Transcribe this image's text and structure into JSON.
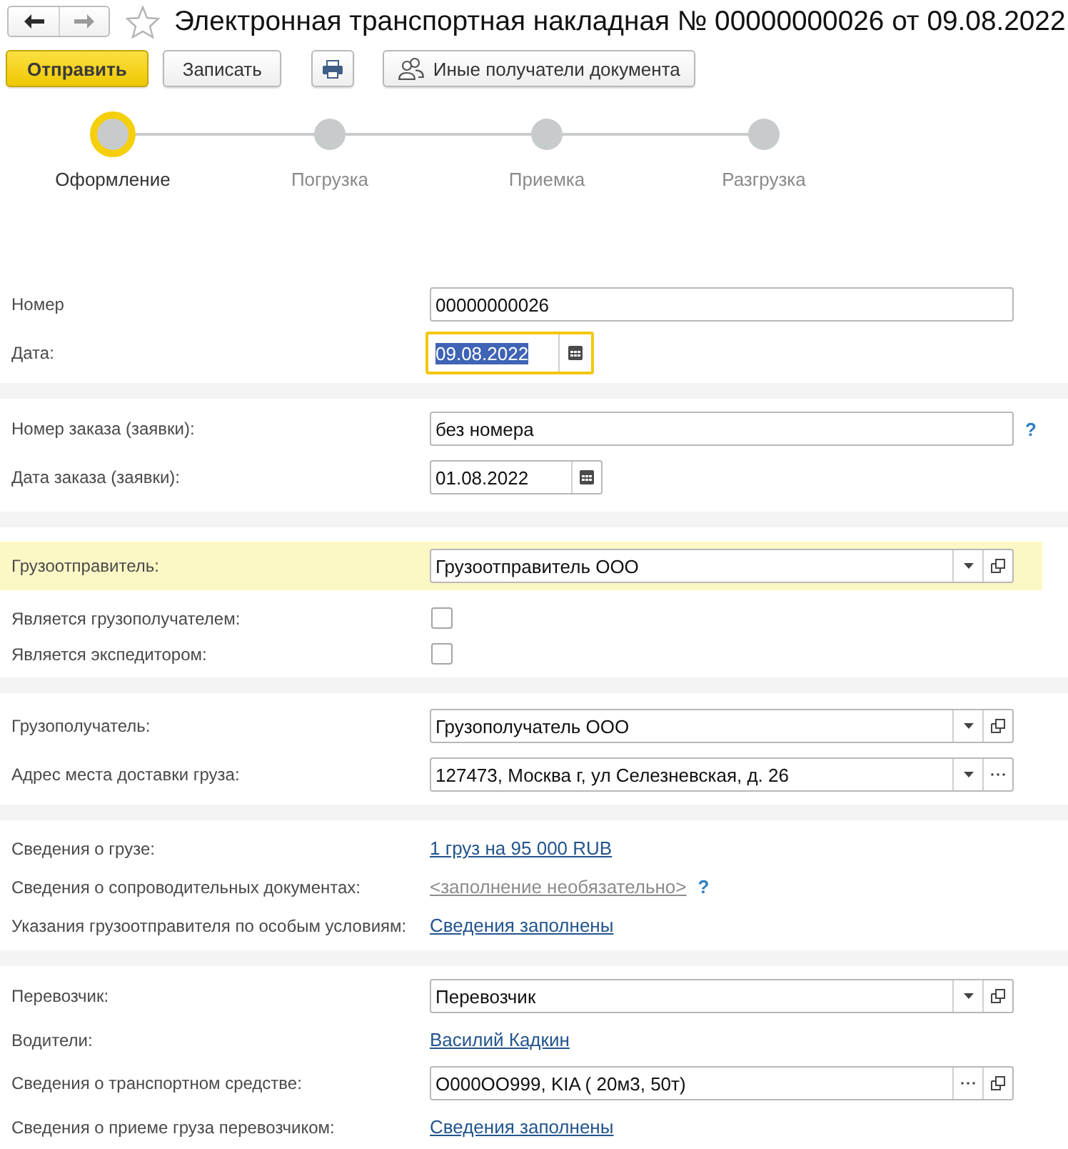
{
  "window": {
    "title": "Электронная транспортная накладная № 00000000026 от 09.08.2022",
    "favorite": false
  },
  "nav_buttons": [
    {
      "kind": "back",
      "disabled": false
    },
    {
      "kind": "forward",
      "disabled": true
    }
  ],
  "toolbar": [
    {
      "kind": "primary",
      "label": "Отправить"
    },
    {
      "kind": "plain",
      "label": "Записать"
    },
    {
      "kind": "print"
    },
    {
      "kind": "people",
      "label": "Иные получатели документа"
    }
  ],
  "steps": [
    {
      "label": "Оформление",
      "selected": true
    },
    {
      "label": "Погрузка",
      "selected": false
    },
    {
      "label": "Приемка",
      "selected": false
    },
    {
      "label": "Разгрузка",
      "selected": false
    }
  ],
  "sections": [
    {
      "rows": [
        {
          "kind": "text",
          "label": "Номер",
          "value": "00000000026",
          "focused": false,
          "highlighted": false
        },
        {
          "kind": "date",
          "label": "Дата:",
          "value": "09.08.2022",
          "focused": true,
          "highlighted": false
        }
      ]
    },
    {
      "rows": [
        {
          "kind": "text",
          "label": "Номер заказа (заявки):",
          "value": "без номера",
          "help": "?",
          "focused": false,
          "highlighted": false
        },
        {
          "kind": "date",
          "label": "Дата заказа (заявки):",
          "value": "01.08.2022",
          "focused": false,
          "highlighted": false
        }
      ]
    },
    {
      "rows": [
        {
          "kind": "select",
          "label": "Грузоотправитель:",
          "value": "Грузоотправитель ООО",
          "buttons": [
            {
              "kind": "dropdown"
            },
            {
              "kind": "open"
            }
          ],
          "focused": false,
          "highlighted": true
        },
        {
          "kind": "checkbox",
          "label": "Является грузополучателем:",
          "checked": false,
          "highlighted": false
        },
        {
          "kind": "checkbox",
          "label": "Является экспедитором:",
          "checked": false,
          "highlighted": false
        }
      ]
    },
    {
      "rows": [
        {
          "kind": "select",
          "label": "Грузополучатель:",
          "value": "Грузополучатель ООО",
          "buttons": [
            {
              "kind": "dropdown"
            },
            {
              "kind": "open"
            }
          ],
          "focused": false,
          "highlighted": false
        },
        {
          "kind": "select",
          "label": "Адрес места доставки груза:",
          "value": "127473, Москва г, ул Селезневская, д. 26",
          "buttons": [
            {
              "kind": "dropdown"
            },
            {
              "kind": "more"
            }
          ],
          "focused": false,
          "highlighted": false
        }
      ]
    },
    {
      "rows": [
        {
          "kind": "link",
          "label": "Сведения о грузе:",
          "value": "1 груз на 95 000 RUB",
          "highlighted": false
        },
        {
          "kind": "link",
          "label": "Сведения о сопроводительных документах:",
          "placeholder": "<заполнение необязательно>",
          "help": "?",
          "highlighted": false
        },
        {
          "kind": "link",
          "label": "Указания грузоотправителя по особым условиям:",
          "value": "Сведения заполнены",
          "highlighted": false
        }
      ]
    },
    {
      "rows": [
        {
          "kind": "select",
          "label": "Перевозчик:",
          "value": "Перевозчик",
          "buttons": [
            {
              "kind": "dropdown"
            },
            {
              "kind": "open"
            }
          ],
          "focused": false,
          "highlighted": false
        },
        {
          "kind": "link",
          "label": "Водители:",
          "value": "Василий Кадкин",
          "highlighted": false
        },
        {
          "kind": "select",
          "label": "Сведения о транспортном средстве:",
          "value": "О000ОО999, KIA ( 20м3, 50т)",
          "buttons": [
            {
              "kind": "more"
            },
            {
              "kind": "open"
            }
          ],
          "focused": false,
          "highlighted": false
        },
        {
          "kind": "link",
          "label": "Сведения о приеме груза перевозчиком:",
          "value": "Сведения заполнены",
          "highlighted": false
        }
      ]
    }
  ]
}
